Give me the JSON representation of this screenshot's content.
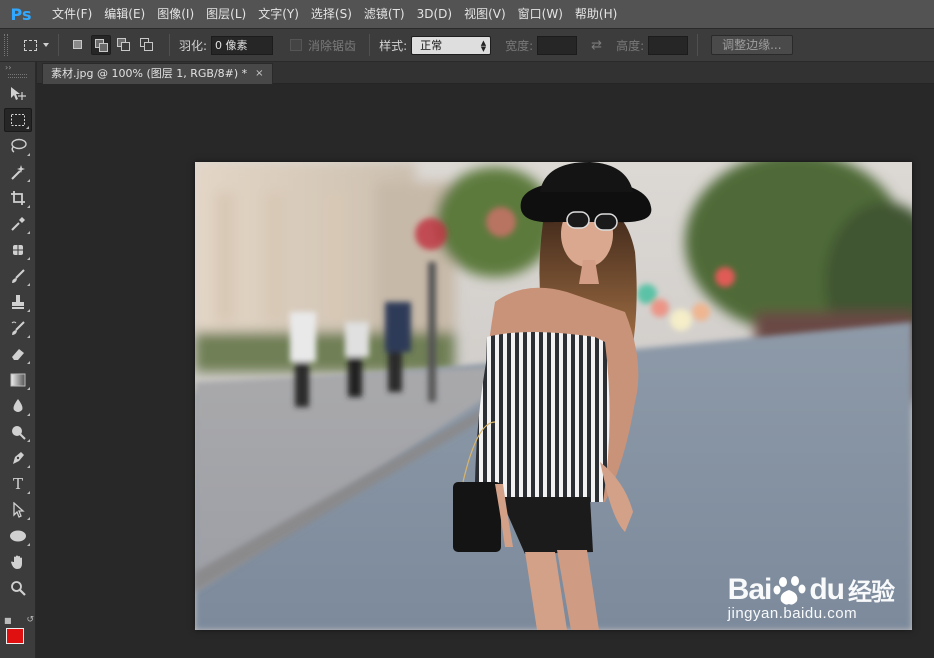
{
  "app": {
    "logo": "Ps"
  },
  "menu": [
    "文件(F)",
    "编辑(E)",
    "图像(I)",
    "图层(L)",
    "文字(Y)",
    "选择(S)",
    "滤镜(T)",
    "3D(D)",
    "视图(V)",
    "窗口(W)",
    "帮助(H)"
  ],
  "options": {
    "feather_label": "羽化:",
    "feather_value": "0 像素",
    "antialias_label": "消除锯齿",
    "style_label": "样式:",
    "style_value": "正常",
    "width_label": "宽度:",
    "height_label": "高度:",
    "refine_edge": "调整边缘..."
  },
  "document": {
    "tab_title": "素材.jpg @ 100% (图层 1, RGB/8#) *",
    "close_symbol": "×"
  },
  "tools": [
    "move-tool",
    "rectangular-marquee-tool",
    "lasso-tool",
    "magic-wand-tool",
    "crop-tool",
    "eyedropper-tool",
    "spot-healing-brush-tool",
    "brush-tool",
    "clone-stamp-tool",
    "history-brush-tool",
    "eraser-tool",
    "gradient-tool",
    "blur-tool",
    "dodge-tool",
    "pen-tool",
    "type-tool",
    "path-selection-tool",
    "ellipse-tool",
    "hand-tool",
    "zoom-tool"
  ],
  "type_tool_glyph": "T",
  "colors": {
    "foreground": "#e01010",
    "background": "#ffffff",
    "ps_blue": "#31a8ff"
  },
  "watermark": {
    "brand_left": "Bai",
    "brand_right": "du",
    "brand_cn": "经验",
    "url": "jingyan.baidu.com"
  }
}
